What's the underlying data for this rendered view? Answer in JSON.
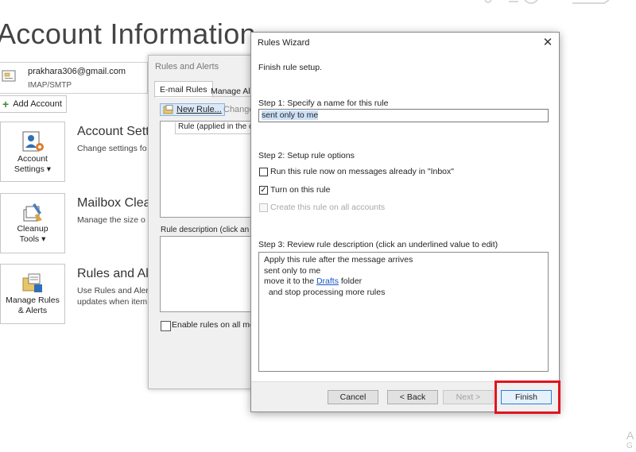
{
  "backstage": {
    "title": "Account Information",
    "account": {
      "email": "prakhara306@gmail.com",
      "type": "IMAP/SMTP"
    },
    "add_account_label": "Add Account",
    "sections": [
      {
        "tile_label_1": "Account",
        "tile_label_2": "Settings ▾",
        "icon": "account-settings-icon",
        "title": "Account Sett",
        "desc_1": "Change settings fo",
        "desc_2": ""
      },
      {
        "tile_label_1": "Cleanup",
        "tile_label_2": "Tools ▾",
        "icon": "cleanup-tools-icon",
        "title": "Mailbox Clea",
        "desc_1": "Manage the size o",
        "desc_2": ""
      },
      {
        "tile_label_1": "Manage Rules",
        "tile_label_2": "& Alerts",
        "icon": "manage-rules-icon",
        "title": "Rules and Al",
        "desc_1": "Use Rules and Alert",
        "desc_2": "updates when item"
      }
    ],
    "corner_text_1": "A",
    "corner_text_2": "G"
  },
  "rules_alerts": {
    "title": "Rules and Alerts",
    "tabs": [
      "E-mail Rules",
      "Manage Al"
    ],
    "new_rule_label": "New Rule...",
    "change_label": "Change",
    "list_header": "Rule (applied in the or",
    "desc_label": "Rule description (click an",
    "enable_label": "Enable rules on all me"
  },
  "wizard": {
    "title": "Rules Wizard",
    "close_glyph": "✕",
    "heading": "Finish rule setup.",
    "step1_label": "Step 1: Specify a name for this rule",
    "rule_name": "sent only to me",
    "step2_label": "Step 2: Setup rule options",
    "options": [
      {
        "label": "Run this rule now on messages already in \"Inbox\"",
        "checked": false,
        "disabled": false
      },
      {
        "label": "Turn on this rule",
        "checked": true,
        "disabled": false
      },
      {
        "label": "Create this rule on all accounts",
        "checked": false,
        "disabled": true
      }
    ],
    "step3_label": "Step 3: Review rule description (click an underlined value to edit)",
    "desc_line1": "Apply this rule after the message arrives",
    "desc_line2": "sent only to me",
    "desc_line3_pre": "move it to the ",
    "desc_line3_link": "Drafts",
    "desc_line3_post": " folder",
    "desc_line4": "  and stop processing more rules",
    "buttons": {
      "cancel": "Cancel",
      "back": "< Back",
      "next": "Next >",
      "finish": "Finish"
    },
    "checkmark": "✓"
  },
  "colors": {
    "highlight": "#e0141e",
    "link": "#1a57c9",
    "selection": "#cce0f7"
  }
}
